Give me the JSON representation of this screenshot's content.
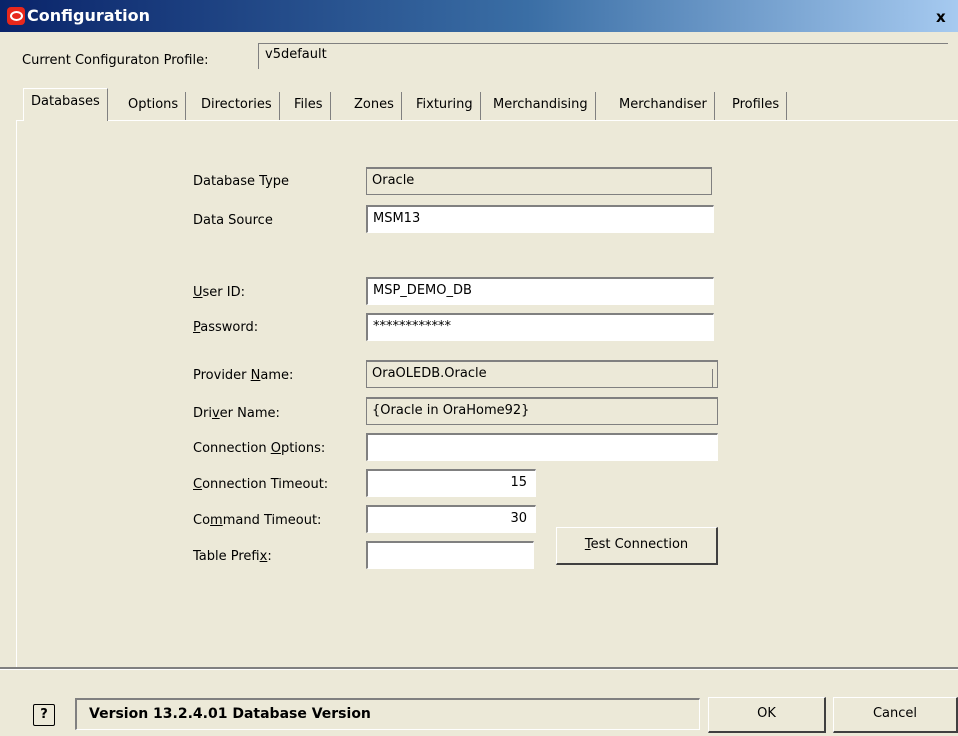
{
  "window": {
    "title": "Configuration",
    "close_label": "x"
  },
  "profile": {
    "label": "Current Configuraton Profile:",
    "value": "v5default"
  },
  "tabs": [
    {
      "label": "Databases",
      "active": true
    },
    {
      "label": "Options"
    },
    {
      "label": "Directories"
    },
    {
      "label": "Files"
    },
    {
      "label": "Zones"
    },
    {
      "label": "Fixturing"
    },
    {
      "label": "Merchandising"
    },
    {
      "label": "Merchandiser"
    },
    {
      "label": "Profiles"
    }
  ],
  "form": {
    "database_type": {
      "label": "Database Type",
      "value": "Oracle"
    },
    "data_source": {
      "label": "Data Source",
      "value": "MSM13"
    },
    "user_id": {
      "label_pre": "",
      "label_key": "U",
      "label_post": "ser ID:",
      "value": "MSP_DEMO_DB"
    },
    "password": {
      "label_pre": "",
      "label_key": "P",
      "label_post": "assword:",
      "value": "************"
    },
    "provider_name": {
      "label_pre": "Provider ",
      "label_key": "N",
      "label_post": "ame:",
      "value": "OraOLEDB.Oracle"
    },
    "driver_name": {
      "label_pre": "Dri",
      "label_key": "v",
      "label_post": "er Name:",
      "value": "{Oracle in OraHome92}"
    },
    "connection_options": {
      "label_pre": "Connection ",
      "label_key": "O",
      "label_post": "ptions:",
      "value": ""
    },
    "connection_timeout": {
      "label_pre": "",
      "label_key": "C",
      "label_post": "onnection Timeout:",
      "value": "15"
    },
    "command_timeout": {
      "label_pre": "Co",
      "label_key": "m",
      "label_post": "mand Timeout:",
      "value": "30"
    },
    "table_prefix": {
      "label_pre": "Table Prefi",
      "label_key": "x",
      "label_post": ":",
      "value": ""
    }
  },
  "buttons": {
    "test_connection_key": "T",
    "test_connection_rest": "est Connection",
    "ok": "OK",
    "cancel": "Cancel"
  },
  "status": {
    "help_icon": "?",
    "text": "Version 13.2.4.01 Database Version"
  }
}
